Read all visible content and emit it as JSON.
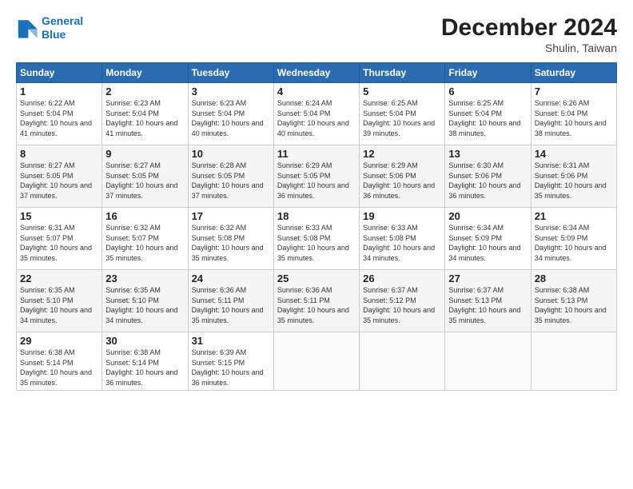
{
  "logo": {
    "line1": "General",
    "line2": "Blue"
  },
  "title": "December 2024",
  "subtitle": "Shulin, Taiwan",
  "weekdays": [
    "Sunday",
    "Monday",
    "Tuesday",
    "Wednesday",
    "Thursday",
    "Friday",
    "Saturday"
  ],
  "weeks": [
    [
      {
        "day": 1,
        "sunrise": "6:22 AM",
        "sunset": "5:04 PM",
        "daylight": "10 hours and 41 minutes."
      },
      {
        "day": 2,
        "sunrise": "6:23 AM",
        "sunset": "5:04 PM",
        "daylight": "10 hours and 41 minutes."
      },
      {
        "day": 3,
        "sunrise": "6:23 AM",
        "sunset": "5:04 PM",
        "daylight": "10 hours and 40 minutes."
      },
      {
        "day": 4,
        "sunrise": "6:24 AM",
        "sunset": "5:04 PM",
        "daylight": "10 hours and 40 minutes."
      },
      {
        "day": 5,
        "sunrise": "6:25 AM",
        "sunset": "5:04 PM",
        "daylight": "10 hours and 39 minutes."
      },
      {
        "day": 6,
        "sunrise": "6:25 AM",
        "sunset": "5:04 PM",
        "daylight": "10 hours and 38 minutes."
      },
      {
        "day": 7,
        "sunrise": "6:26 AM",
        "sunset": "5:04 PM",
        "daylight": "10 hours and 38 minutes."
      }
    ],
    [
      {
        "day": 8,
        "sunrise": "6:27 AM",
        "sunset": "5:05 PM",
        "daylight": "10 hours and 37 minutes."
      },
      {
        "day": 9,
        "sunrise": "6:27 AM",
        "sunset": "5:05 PM",
        "daylight": "10 hours and 37 minutes."
      },
      {
        "day": 10,
        "sunrise": "6:28 AM",
        "sunset": "5:05 PM",
        "daylight": "10 hours and 37 minutes."
      },
      {
        "day": 11,
        "sunrise": "6:29 AM",
        "sunset": "5:05 PM",
        "daylight": "10 hours and 36 minutes."
      },
      {
        "day": 12,
        "sunrise": "6:29 AM",
        "sunset": "5:06 PM",
        "daylight": "10 hours and 36 minutes."
      },
      {
        "day": 13,
        "sunrise": "6:30 AM",
        "sunset": "5:06 PM",
        "daylight": "10 hours and 36 minutes."
      },
      {
        "day": 14,
        "sunrise": "6:31 AM",
        "sunset": "5:06 PM",
        "daylight": "10 hours and 35 minutes."
      }
    ],
    [
      {
        "day": 15,
        "sunrise": "6:31 AM",
        "sunset": "5:07 PM",
        "daylight": "10 hours and 35 minutes."
      },
      {
        "day": 16,
        "sunrise": "6:32 AM",
        "sunset": "5:07 PM",
        "daylight": "10 hours and 35 minutes."
      },
      {
        "day": 17,
        "sunrise": "6:32 AM",
        "sunset": "5:08 PM",
        "daylight": "10 hours and 35 minutes."
      },
      {
        "day": 18,
        "sunrise": "6:33 AM",
        "sunset": "5:08 PM",
        "daylight": "10 hours and 35 minutes."
      },
      {
        "day": 19,
        "sunrise": "6:33 AM",
        "sunset": "5:08 PM",
        "daylight": "10 hours and 34 minutes."
      },
      {
        "day": 20,
        "sunrise": "6:34 AM",
        "sunset": "5:09 PM",
        "daylight": "10 hours and 34 minutes."
      },
      {
        "day": 21,
        "sunrise": "6:34 AM",
        "sunset": "5:09 PM",
        "daylight": "10 hours and 34 minutes."
      }
    ],
    [
      {
        "day": 22,
        "sunrise": "6:35 AM",
        "sunset": "5:10 PM",
        "daylight": "10 hours and 34 minutes."
      },
      {
        "day": 23,
        "sunrise": "6:35 AM",
        "sunset": "5:10 PM",
        "daylight": "10 hours and 34 minutes."
      },
      {
        "day": 24,
        "sunrise": "6:36 AM",
        "sunset": "5:11 PM",
        "daylight": "10 hours and 35 minutes."
      },
      {
        "day": 25,
        "sunrise": "6:36 AM",
        "sunset": "5:11 PM",
        "daylight": "10 hours and 35 minutes."
      },
      {
        "day": 26,
        "sunrise": "6:37 AM",
        "sunset": "5:12 PM",
        "daylight": "10 hours and 35 minutes."
      },
      {
        "day": 27,
        "sunrise": "6:37 AM",
        "sunset": "5:13 PM",
        "daylight": "10 hours and 35 minutes."
      },
      {
        "day": 28,
        "sunrise": "6:38 AM",
        "sunset": "5:13 PM",
        "daylight": "10 hours and 35 minutes."
      }
    ],
    [
      {
        "day": 29,
        "sunrise": "6:38 AM",
        "sunset": "5:14 PM",
        "daylight": "10 hours and 35 minutes."
      },
      {
        "day": 30,
        "sunrise": "6:38 AM",
        "sunset": "5:14 PM",
        "daylight": "10 hours and 36 minutes."
      },
      {
        "day": 31,
        "sunrise": "6:39 AM",
        "sunset": "5:15 PM",
        "daylight": "10 hours and 36 minutes."
      },
      null,
      null,
      null,
      null
    ]
  ]
}
